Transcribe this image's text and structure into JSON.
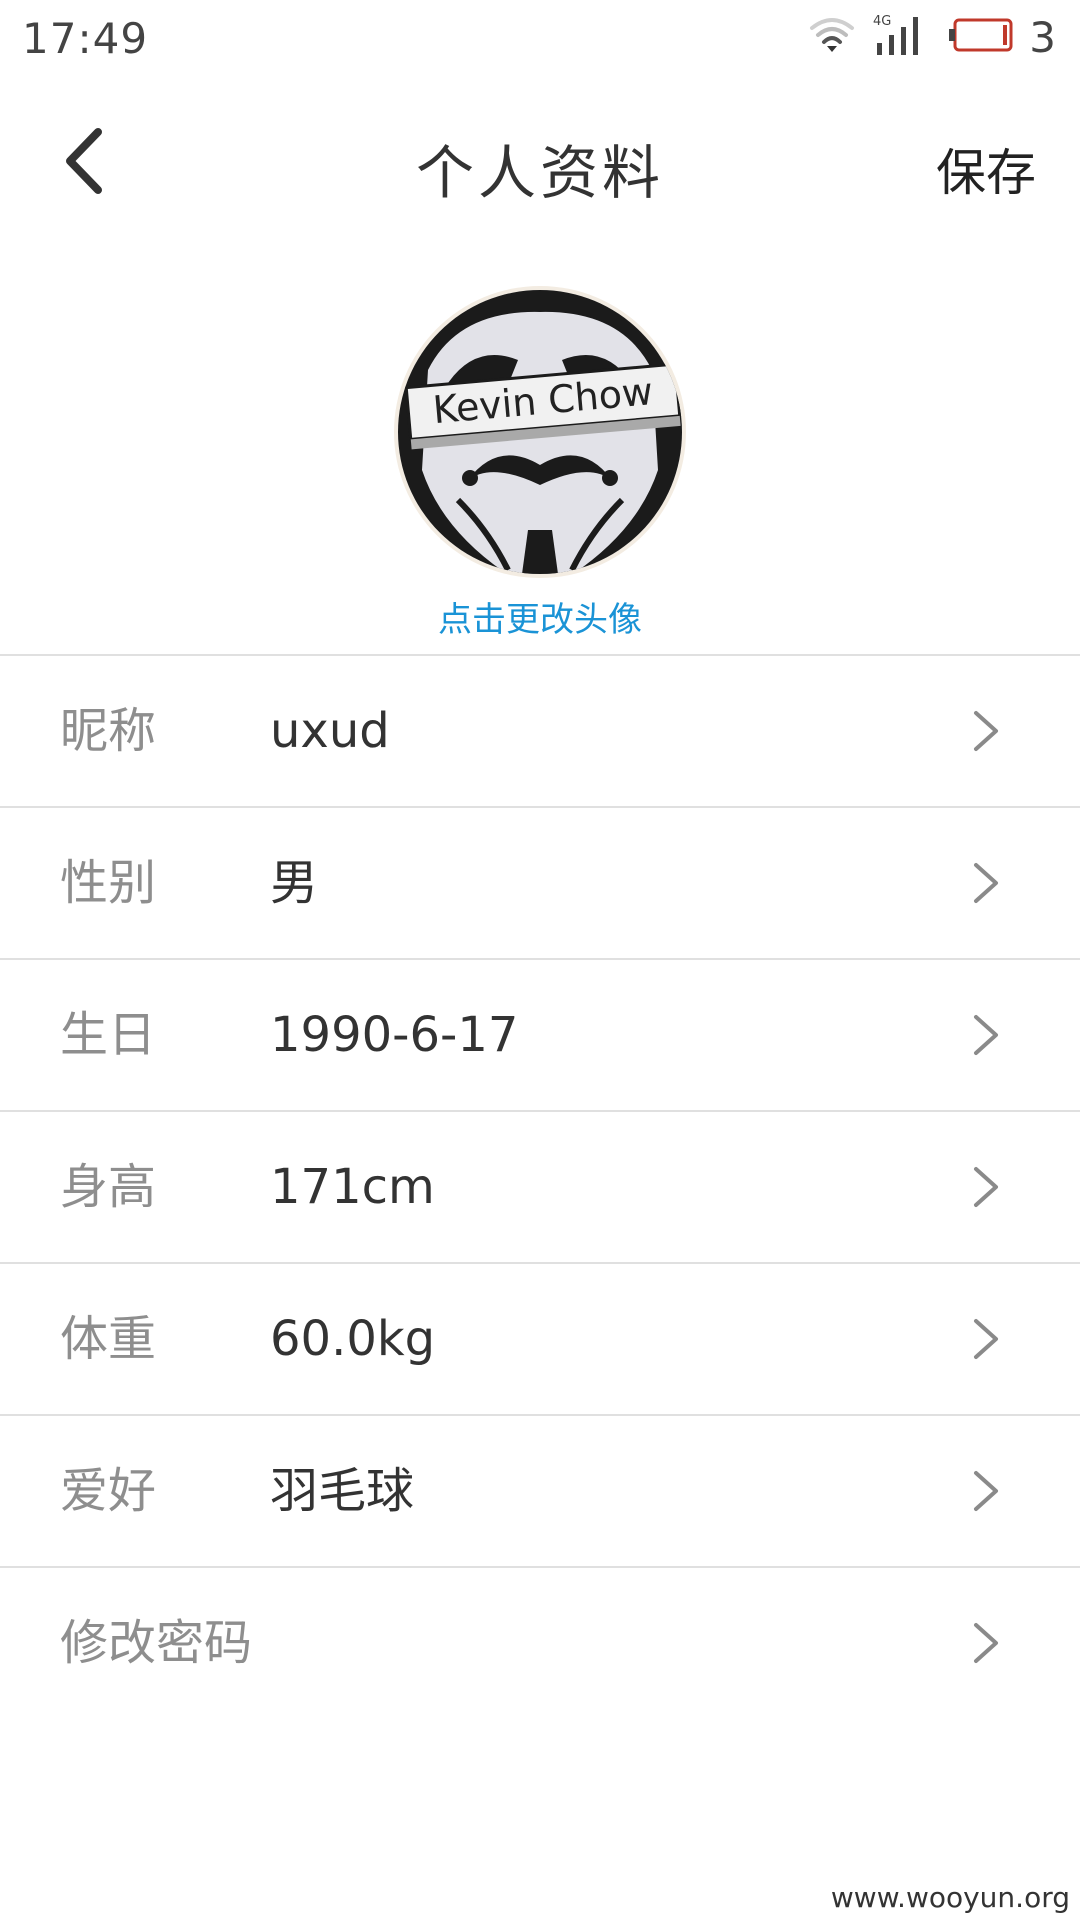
{
  "status_bar": {
    "time": "17:49",
    "network": "4G",
    "battery_count": "3",
    "icons": [
      "wifi-icon",
      "signal-4g-icon",
      "battery-icon"
    ]
  },
  "header": {
    "title": "个人资料",
    "save_label": "保存",
    "back_icon": "chevron-left-icon"
  },
  "avatar": {
    "text": "Kevin Chow",
    "change_label": "点击更改头像"
  },
  "profile_items": [
    {
      "label": "昵称",
      "value": "uxud"
    },
    {
      "label": "性别",
      "value": "男"
    },
    {
      "label": "生日",
      "value": "1990-6-17"
    },
    {
      "label": "身高",
      "value": "171cm"
    },
    {
      "label": "体重",
      "value": "60.0kg"
    },
    {
      "label": "爱好",
      "value": "羽毛球"
    },
    {
      "label": "修改密码",
      "value": ""
    }
  ],
  "watermark": "www.wooyun.org",
  "colors": {
    "accent": "#1a93d6",
    "label": "#8e8e8e",
    "value": "#333333",
    "divider": "#e0e0e0",
    "battery_low": "#c0392b"
  }
}
